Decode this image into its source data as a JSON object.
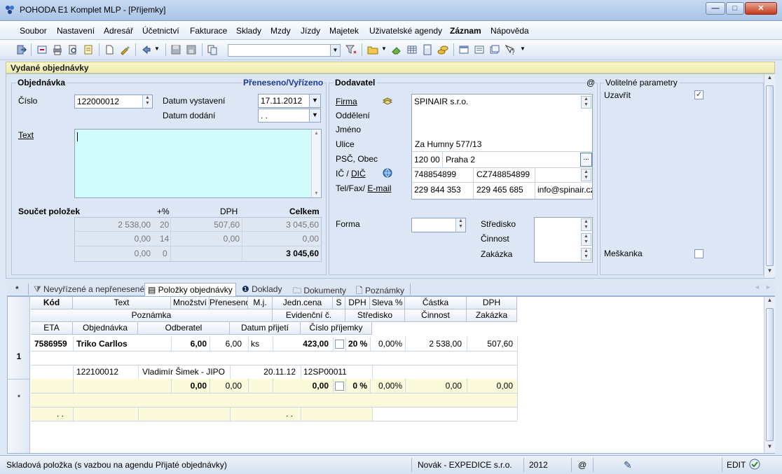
{
  "window": {
    "title": "POHODA E1 Komplet MLP - [Příjemky]"
  },
  "menu": [
    "Soubor",
    "Nastavení",
    "Adresář",
    "Účetnictví",
    "Fakturace",
    "Sklady",
    "Mzdy",
    "Jízdy",
    "Majetek",
    "Uživatelské agendy",
    "Záznam",
    "Nápověda"
  ],
  "agenda_title": "Vydané objednávky",
  "order": {
    "section": "Objednávka",
    "status_link": "Přeneseno/Vyřízeno",
    "cislo_label": "Číslo",
    "cislo_value": "122000012",
    "datum_vystaveni_label": "Datum vystavení",
    "datum_vystaveni_value": "17.11.2012",
    "datum_dodani_label": "Datum dodání",
    "datum_dodani_value": ". .",
    "text_label": "Text",
    "text_value": ""
  },
  "summary": {
    "label": "Součet položek",
    "col_pct": "+%",
    "col_dph": "DPH",
    "col_celkem": "Celkem",
    "rows": [
      {
        "base": "2 538,00",
        "pct": "20",
        "dph": "507,60",
        "total": "3 045,60"
      },
      {
        "base": "0,00",
        "pct": "14",
        "dph": "0,00",
        "total": "0,00"
      },
      {
        "base": "0,00",
        "pct": "0",
        "dph": "",
        "total": "3 045,60"
      }
    ]
  },
  "supplier": {
    "section": "Dodavatel",
    "at_sign": "@",
    "firma_label": "Firma",
    "firma_value": "SPINAIR s.r.o.",
    "oddeleni_label": "Oddělení",
    "jmeno_label": "Jméno",
    "ulice_label": "Ulice",
    "ulice_value": "Za Humny 577/13",
    "psc_label": "PSČ, Obec",
    "psc_value": "120 00",
    "obec_value": "Praha 2",
    "ic_dic_label_ic": "IČ / ",
    "ic_dic_label_dic": "DIČ",
    "ic_value": "748854899",
    "dic_value": "CZ748854899",
    "contact_label_prefix": "Tel/Fax/ ",
    "contact_label_email": "E-mail",
    "tel_value": "229 844 353",
    "fax_value": "229 465 685",
    "email_value": "info@spinair.cz",
    "forma_label": "Forma",
    "stredisko_label": "Středisko",
    "cinnost_label": "Činnost",
    "zakazka_label": "Zakázka"
  },
  "params": {
    "section": "Volitelné parametry",
    "uzavrit_label": "Uzavřít",
    "uzavrit_checked": true,
    "meskanka_label": "Meškanka",
    "meskanka_checked": false
  },
  "tabs": {
    "star": "*",
    "items": [
      "Nevyřízené a nepřenesené",
      "Položky objednávky",
      "Doklady",
      "Dokumenty",
      "Poznámky"
    ]
  },
  "grid": {
    "header1": [
      "Kód",
      "Text",
      "Množství",
      "Přeneseno",
      "M.j.",
      "Jedn.cena",
      "S",
      "DPH",
      "Sleva %",
      "Částka",
      "DPH"
    ],
    "header2": [
      "Poznámka",
      "Evidenční č.",
      "Středisko",
      "Činnost",
      "Zakázka"
    ],
    "header3": [
      "ETA",
      "Objednávka",
      "Odberatel",
      "Datum přijetí",
      "Číslo příjemky"
    ],
    "row1": {
      "index": "1",
      "kod": "7586959",
      "text": "Triko Carllos",
      "mnozstvi": "6,00",
      "preneseno": "6,00",
      "mj": "ks",
      "cena": "423,00",
      "dph_pct": "20 %",
      "sleva": "0,00%",
      "castka": "2 538,00",
      "dph": "507,60",
      "objednavka": "122100012",
      "odberatel": "Vladimír Šimek - JIPO",
      "datum_prijeti": "20.11.12",
      "cislo_prijemky": "12SP00011"
    },
    "newrow": {
      "index": "*",
      "mnozstvi": "0,00",
      "preneseno": "0,00",
      "cena": "0,00",
      "dph_pct": "0 %",
      "sleva": "0,00%",
      "castka": "0,00",
      "dph": "0,00",
      "eta": ". .",
      "datum_prijeti": ". ."
    }
  },
  "status": {
    "message": "Skladová položka (s vazbou na agendu Přijaté objednávky)",
    "user": "Novák - EXPEDICE s.r.o.",
    "year": "2012",
    "at": "@",
    "mode": "EDIT"
  }
}
